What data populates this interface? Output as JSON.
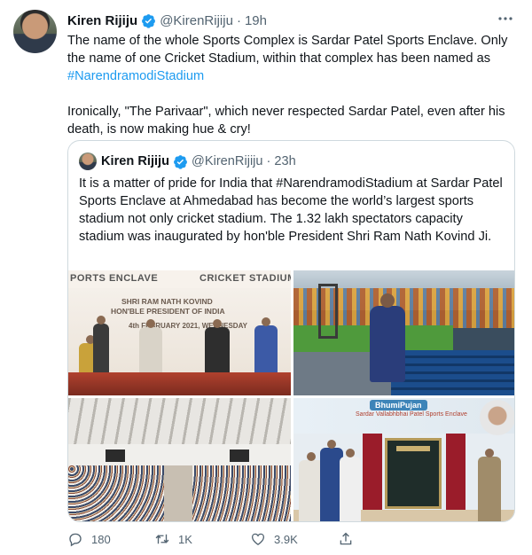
{
  "author": {
    "name": "Kiren Rijiju",
    "handle": "@KirenRijiju",
    "separator": "·",
    "time": "19h",
    "verified": true
  },
  "tweet": {
    "paragraph1_text": "The name of the whole Sports Complex is Sardar Patel Sports Enclave. Only the name of one Cricket Stadium, within that complex has been named as ",
    "paragraph1_hashtag": "#NarendramodiStadium",
    "paragraph2": "Ironically, \"The Parivaar\", which never respected Sardar Patel, even after his death, is now making hue & cry!"
  },
  "quoted": {
    "name": "Kiren Rijiju",
    "handle": "@KirenRijiju",
    "separator": "·",
    "time": "23h",
    "text": "It is a matter of pride for India that #NarendramodiStadium at Sardar Patel Sports Enclave at Ahmedabad has become the world’s largest sports stadium not only cricket stadium. The 1.32 lakh spectators capacity stadium was inaugurated by hon'ble President Shri Ram Nath Kovind Ji.",
    "media": {
      "image1_banner_left": "PORTS ENCLAVE",
      "image1_banner_right": "CRICKET STADIUM",
      "image1_line1": "SHRI RAM NATH KOVIND",
      "image1_line2": "HON'BLE PRESIDENT OF INDIA",
      "image1_line3": "4th FEBRUARY 2021, WEDNESDAY",
      "image4_title": "BhumiPujan",
      "image4_subtitle": "Sardar Vallabhbhai Patel Sports Enclave"
    }
  },
  "actions": {
    "reply_count": "180",
    "retweet_count": "1K",
    "like_count": "3.9K"
  },
  "colors": {
    "link": "#1d9bf0",
    "secondary_text": "#536471",
    "border": "#cfd9de",
    "verified": "#1d9bf0"
  },
  "icons": [
    "more-icon",
    "verified-icon",
    "reply-icon",
    "retweet-icon",
    "like-icon",
    "share-icon"
  ]
}
